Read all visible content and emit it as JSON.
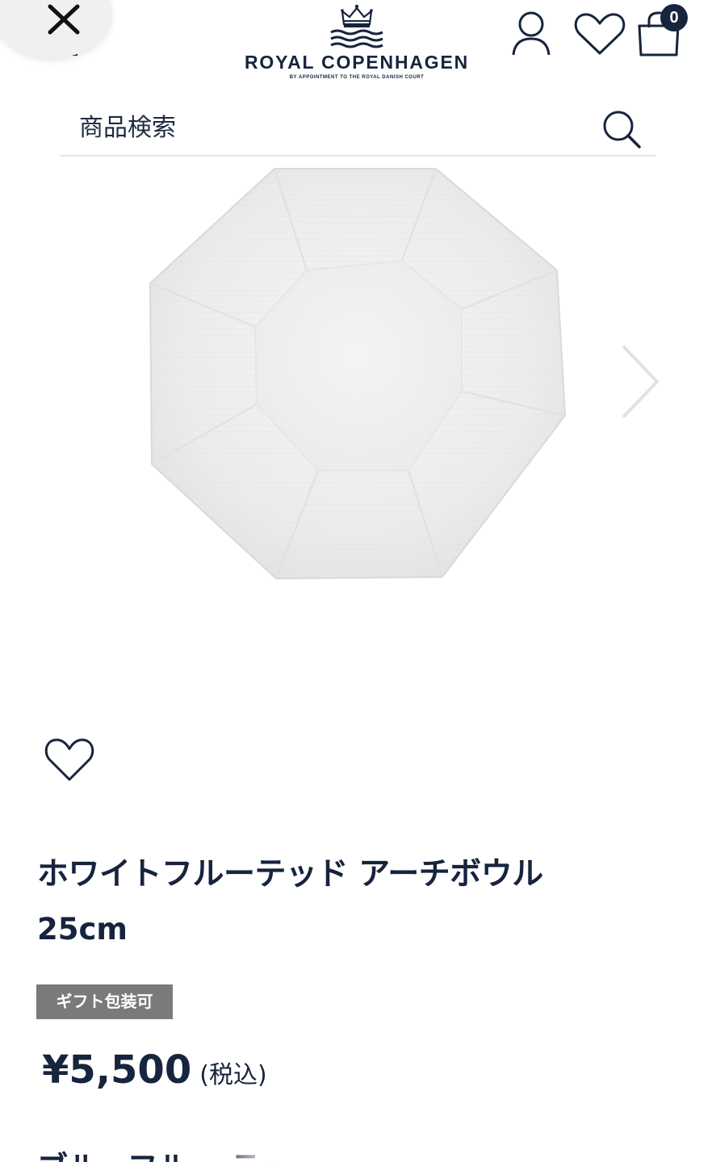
{
  "header": {
    "brand_name": "ROYAL COPENHAGEN",
    "brand_tagline": "BY APPOINTMENT TO THE ROYAL DANISH COURT",
    "cart_count": "0"
  },
  "search": {
    "placeholder": "商品検索"
  },
  "product": {
    "name": "ホワイトフルーテッド アーチボウル",
    "size": "25cm",
    "gift_badge": "ギフト包装可",
    "price": "¥5,500",
    "tax_note": "(税込)",
    "next_title_partial": "ブルーフルー                テッド メガ"
  },
  "icons": {
    "close": "close-icon",
    "menu": "menu-icon",
    "account": "user-icon",
    "wishlist": "heart-icon",
    "cart": "shopping-bag-icon",
    "search": "search-icon",
    "next": "chevron-right-icon"
  },
  "colors": {
    "brand_navy": "#16243d",
    "badge_gray": "#7a7a7a"
  }
}
